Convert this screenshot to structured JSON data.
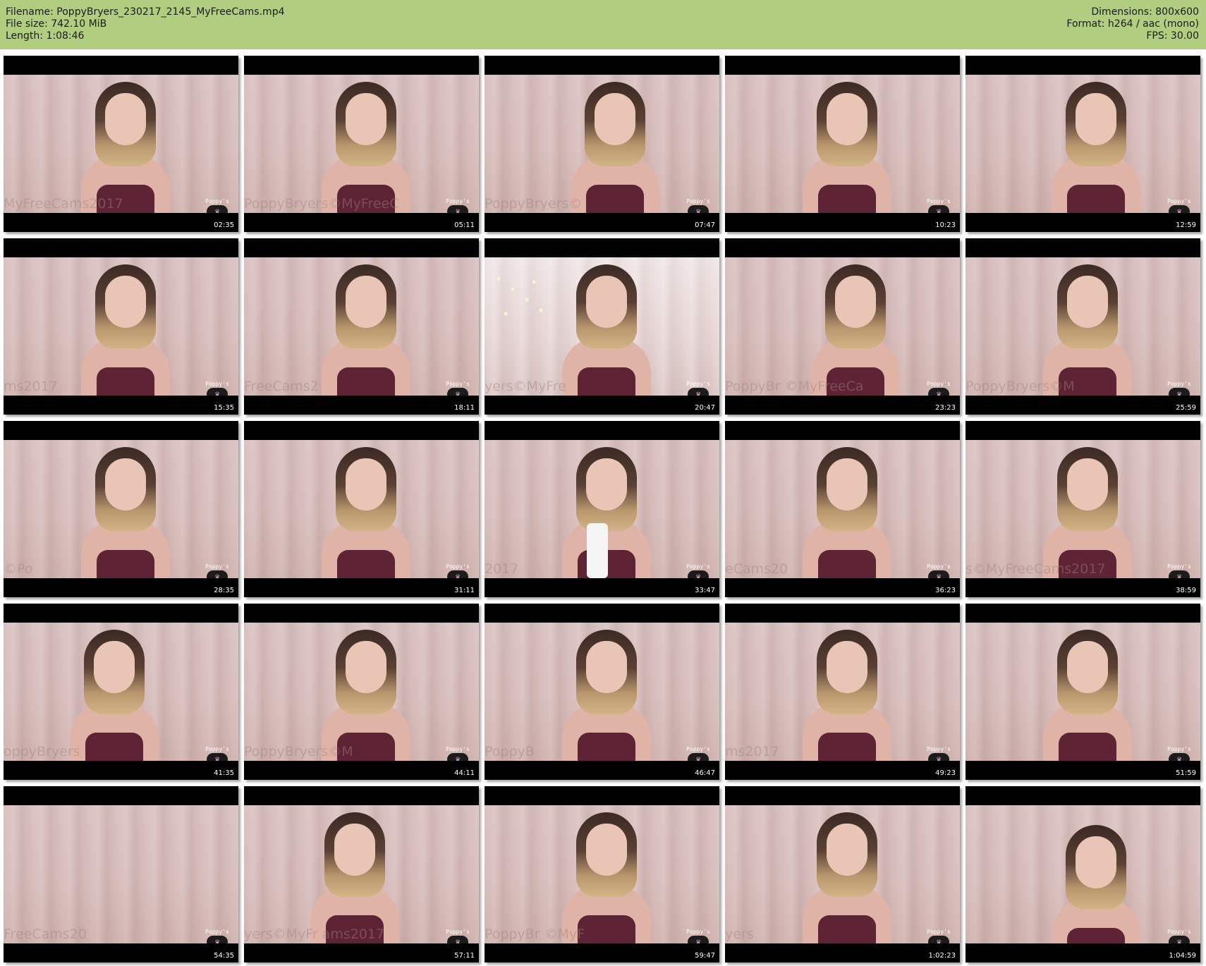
{
  "header": {
    "filename": "Filename: PoppyBryers_230217_2145_MyFreeCams.mp4",
    "filesize": "File size: 742.10 MiB",
    "length": "Length: 1:08:46",
    "dimensions": "Dimensions: 800x600",
    "format": "Format: h264 / aac (mono)",
    "fps": "FPS: 30.00"
  },
  "logo": {
    "line1": "Poppy's",
    "line2": "PlayGround",
    "icon": "crown-icon"
  },
  "colors": {
    "header_bg": "#b1cd80",
    "letterbox": "#000000",
    "top": "#5e2335"
  },
  "thumbnails": [
    {
      "time": "02:35",
      "watermark": "MyFreeCams2017"
    },
    {
      "time": "05:11",
      "watermark": "PoppyBryers©MyFreeC"
    },
    {
      "time": "07:47",
      "watermark": "PoppyBryers©"
    },
    {
      "time": "10:23",
      "watermark": ""
    },
    {
      "time": "12:59",
      "watermark": ""
    },
    {
      "time": "15:35",
      "watermark": "ms2017"
    },
    {
      "time": "18:11",
      "watermark": "FreeCams2"
    },
    {
      "time": "20:47",
      "watermark": "yers©MyFre"
    },
    {
      "time": "23:23",
      "watermark": "PoppyBr ©MyFreeCa"
    },
    {
      "time": "25:59",
      "watermark": "PoppyBryers©M"
    },
    {
      "time": "28:35",
      "watermark": "©Po"
    },
    {
      "time": "31:11",
      "watermark": ""
    },
    {
      "time": "33:47",
      "watermark": "2017"
    },
    {
      "time": "36:23",
      "watermark": "eCams20"
    },
    {
      "time": "38:59",
      "watermark": "s©MyFreeCams2017"
    },
    {
      "time": "41:35",
      "watermark": "oppyBryers"
    },
    {
      "time": "44:11",
      "watermark": "PoppyBryers©M"
    },
    {
      "time": "46:47",
      "watermark": "PoppyB"
    },
    {
      "time": "49:23",
      "watermark": "ms2017"
    },
    {
      "time": "51:59",
      "watermark": ""
    },
    {
      "time": "54:35",
      "watermark": "FreeCams20"
    },
    {
      "time": "57:11",
      "watermark": "yers©MyFr ams2017"
    },
    {
      "time": "59:47",
      "watermark": "PoppyBr ©MyF"
    },
    {
      "time": "1:02:23",
      "watermark": "yers"
    },
    {
      "time": "1:04:59",
      "watermark": ""
    }
  ]
}
